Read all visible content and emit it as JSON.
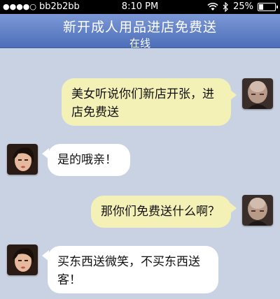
{
  "status": {
    "carrier": "bb2b2bb",
    "time": "8:10 PM",
    "battery": "25%",
    "battery_level": 0.25
  },
  "header": {
    "title": "新开成人用品进店免费送",
    "subtitle": "在线"
  },
  "messages": [
    {
      "side": "out",
      "text": "美女听说你们新店开张，进店免费送"
    },
    {
      "side": "in",
      "text": "是的哦亲！"
    },
    {
      "side": "out",
      "text": "那你们免费送什么啊？"
    },
    {
      "side": "in",
      "text": "买东西送微笑，不买东西送客！"
    }
  ],
  "colors": {
    "background": "#c9d2e2",
    "nav": "#4d6fb9",
    "outgoing_bubble": "#f4f1b7",
    "incoming_bubble": "#ffffff"
  }
}
